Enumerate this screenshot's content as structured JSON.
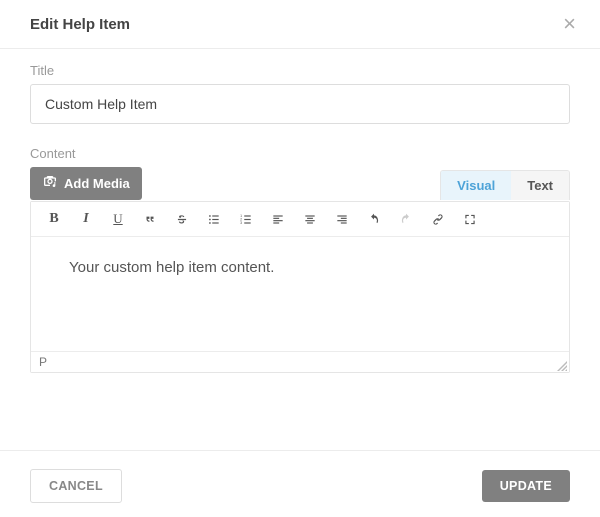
{
  "header": {
    "title": "Edit Help Item"
  },
  "fields": {
    "title_label": "Title",
    "title_value": "Custom Help Item",
    "content_label": "Content"
  },
  "media": {
    "add_media_label": "Add Media"
  },
  "tabs": {
    "visual": "Visual",
    "text": "Text",
    "active": "visual"
  },
  "toolbar": {
    "bold": "B",
    "italic": "I",
    "underline": "U"
  },
  "editor": {
    "content": "Your custom help item content.",
    "status_path": "P"
  },
  "footer": {
    "cancel": "CANCEL",
    "update": "UPDATE"
  },
  "colors": {
    "accent": "#4da3d8",
    "button_gray": "#808080"
  }
}
